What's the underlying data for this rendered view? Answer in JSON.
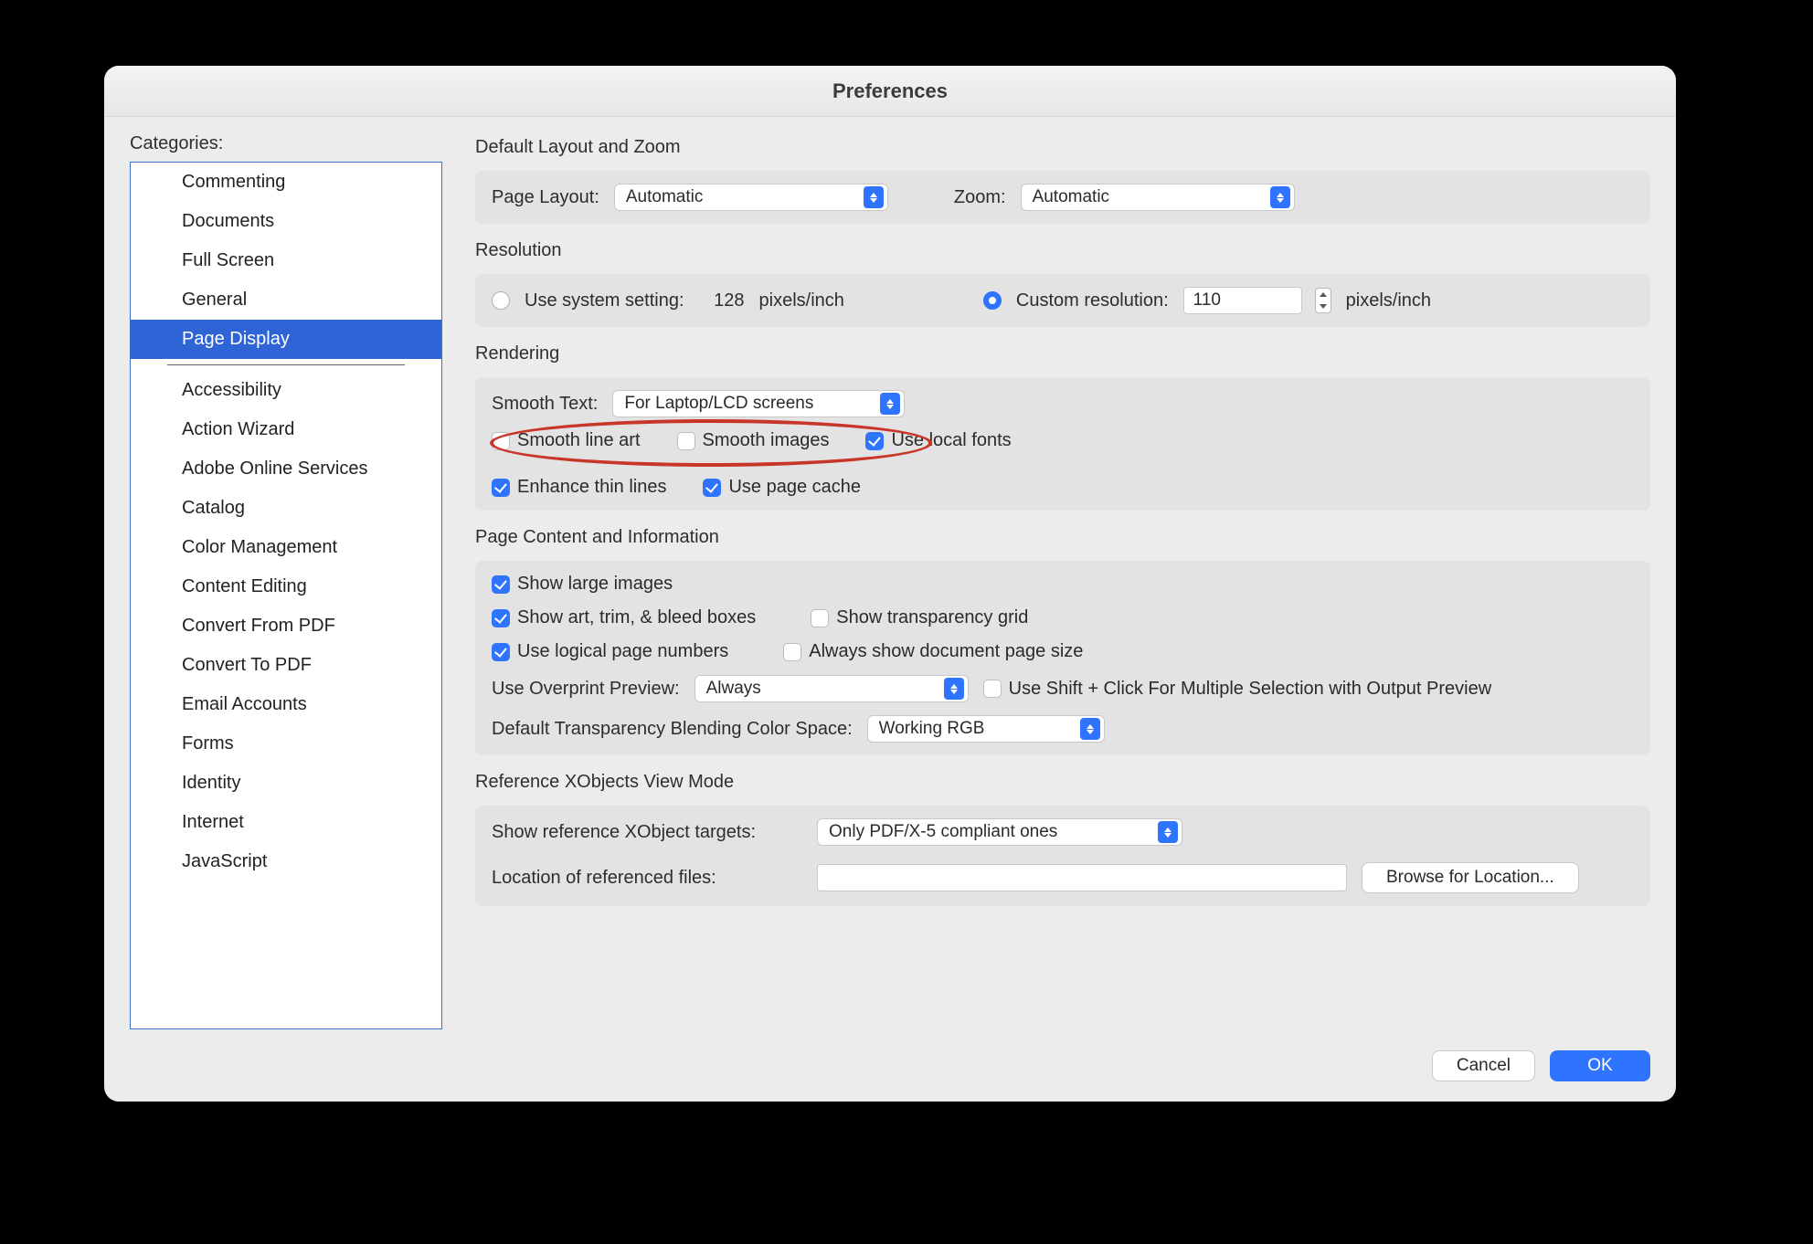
{
  "window": {
    "title": "Preferences"
  },
  "sidebar": {
    "label": "Categories:",
    "top_items": [
      "Commenting",
      "Documents",
      "Full Screen",
      "General",
      "Page Display"
    ],
    "selected_index": 4,
    "bottom_items": [
      "Accessibility",
      "Action Wizard",
      "Adobe Online Services",
      "Catalog",
      "Color Management",
      "Content Editing",
      "Convert From PDF",
      "Convert To PDF",
      "Email Accounts",
      "Forms",
      "Identity",
      "Internet",
      "JavaScript"
    ]
  },
  "layout_zoom": {
    "title": "Default Layout and Zoom",
    "page_layout_label": "Page Layout:",
    "page_layout_value": "Automatic",
    "zoom_label": "Zoom:",
    "zoom_value": "Automatic"
  },
  "resolution": {
    "title": "Resolution",
    "use_system_label": "Use system setting:",
    "use_system_checked": false,
    "system_value": "128",
    "custom_label": "Custom resolution:",
    "custom_checked": true,
    "custom_value": "110",
    "unit": "pixels/inch"
  },
  "rendering": {
    "title": "Rendering",
    "smooth_text_label": "Smooth Text:",
    "smooth_text_value": "For Laptop/LCD screens",
    "smooth_line_art": {
      "label": "Smooth line art",
      "checked": false
    },
    "smooth_images": {
      "label": "Smooth images",
      "checked": false
    },
    "use_local_fonts": {
      "label": "Use local fonts",
      "checked": true
    },
    "enhance_thin": {
      "label": "Enhance thin lines",
      "checked": true
    },
    "use_page_cache": {
      "label": "Use page cache",
      "checked": true
    }
  },
  "page_content": {
    "title": "Page Content and Information",
    "show_large_images": {
      "label": "Show large images",
      "checked": true
    },
    "show_art_trim": {
      "label": "Show art, trim, & bleed boxes",
      "checked": true
    },
    "show_transparency": {
      "label": "Show transparency grid",
      "checked": false
    },
    "use_logical": {
      "label": "Use logical page numbers",
      "checked": true
    },
    "always_show_size": {
      "label": "Always show document page size",
      "checked": false
    },
    "overprint_label": "Use Overprint Preview:",
    "overprint_value": "Always",
    "shift_click": {
      "label": "Use Shift + Click For Multiple Selection with Output Preview",
      "checked": false
    },
    "blend_label": "Default Transparency Blending Color Space:",
    "blend_value": "Working RGB"
  },
  "xobjects": {
    "title": "Reference XObjects View Mode",
    "targets_label": "Show reference XObject targets:",
    "targets_value": "Only PDF/X-5 compliant ones",
    "location_label": "Location of referenced files:",
    "location_value": "",
    "browse_button": "Browse for Location..."
  },
  "footer": {
    "cancel": "Cancel",
    "ok": "OK"
  }
}
